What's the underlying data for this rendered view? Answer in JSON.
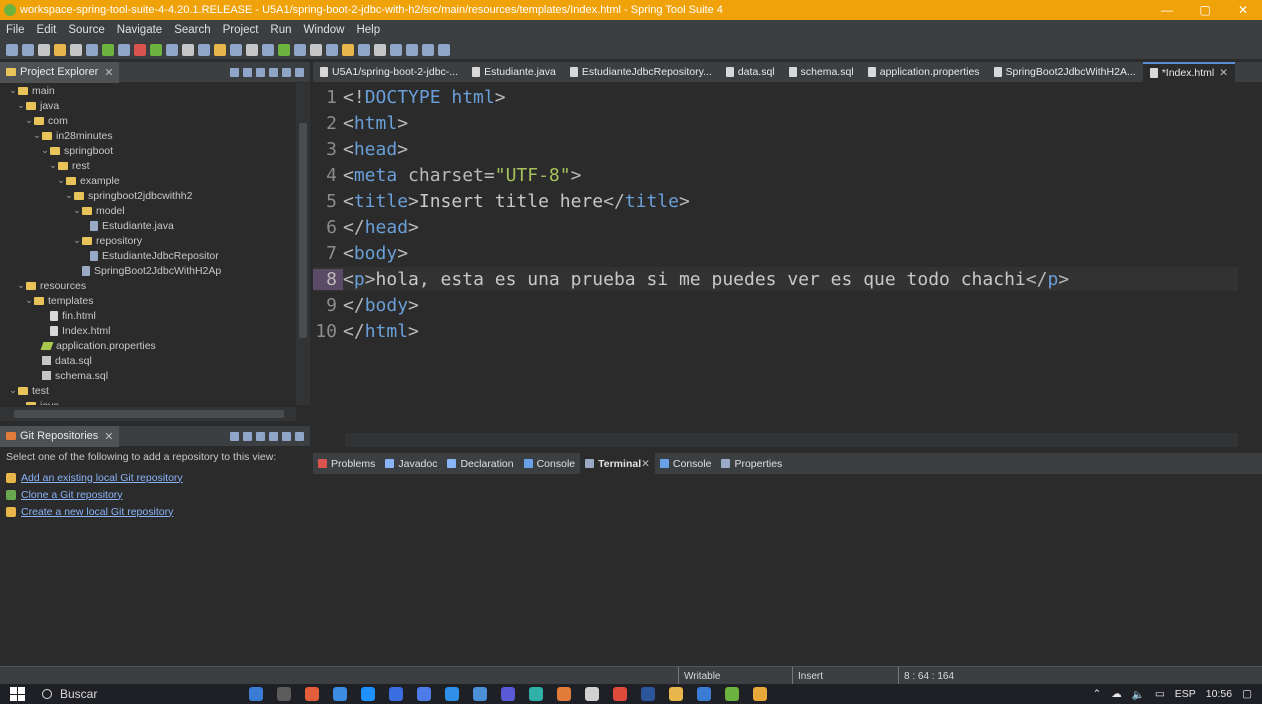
{
  "window": {
    "title": "workspace-spring-tool-suite-4-4.20.1.RELEASE - U5A1/spring-boot-2-jdbc-with-h2/src/main/resources/templates/Index.html - Spring Tool Suite 4",
    "minimize": "—",
    "maximize": "▢",
    "close": "✕"
  },
  "menu": [
    "File",
    "Edit",
    "Source",
    "Navigate",
    "Search",
    "Project",
    "Run",
    "Window",
    "Help"
  ],
  "explorer": {
    "tab_label": "Project Explorer",
    "tree": [
      {
        "indent": 1,
        "chev": "⌄",
        "type": "folder",
        "label": "main"
      },
      {
        "indent": 2,
        "chev": "⌄",
        "type": "folder",
        "label": "java"
      },
      {
        "indent": 3,
        "chev": "⌄",
        "type": "folder",
        "label": "com"
      },
      {
        "indent": 4,
        "chev": "⌄",
        "type": "folder",
        "label": "in28minutes"
      },
      {
        "indent": 5,
        "chev": "⌄",
        "type": "folder",
        "label": "springboot"
      },
      {
        "indent": 6,
        "chev": "⌄",
        "type": "folder",
        "label": "rest"
      },
      {
        "indent": 7,
        "chev": "⌄",
        "type": "folder",
        "label": "example"
      },
      {
        "indent": 8,
        "chev": "⌄",
        "type": "folder",
        "label": "springboot2jdbcwithh2"
      },
      {
        "indent": 9,
        "chev": "⌄",
        "type": "folder",
        "label": "model"
      },
      {
        "indent": 10,
        "chev": "",
        "type": "java",
        "label": "Estudiante.java"
      },
      {
        "indent": 9,
        "chev": "⌄",
        "type": "folder",
        "label": "repository"
      },
      {
        "indent": 10,
        "chev": "",
        "type": "java",
        "label": "EstudianteJdbcRepositor"
      },
      {
        "indent": 9,
        "chev": "",
        "type": "java",
        "label": "SpringBoot2JdbcWithH2Ap"
      },
      {
        "indent": 2,
        "chev": "⌄",
        "type": "folder",
        "label": "resources"
      },
      {
        "indent": 3,
        "chev": "⌄",
        "type": "folder",
        "label": "templates"
      },
      {
        "indent": 5,
        "chev": "",
        "type": "file",
        "label": "fin.html"
      },
      {
        "indent": 5,
        "chev": "",
        "type": "file",
        "label": "Index.html"
      },
      {
        "indent": 4,
        "chev": "",
        "type": "prop",
        "label": "application.properties"
      },
      {
        "indent": 4,
        "chev": "",
        "type": "sql",
        "label": "data.sql"
      },
      {
        "indent": 4,
        "chev": "",
        "type": "sql",
        "label": "schema.sql"
      },
      {
        "indent": 1,
        "chev": "⌄",
        "type": "folder",
        "label": "test"
      },
      {
        "indent": 2,
        "chev": "⌄",
        "type": "folder",
        "label": "java"
      }
    ]
  },
  "git": {
    "tab_label": "Git Repositories",
    "hint": "Select one of the following to add a repository to this view:",
    "links": [
      {
        "label": "Add an existing local Git repository",
        "color": "#e8b64a"
      },
      {
        "label": "Clone a Git repository",
        "color": "#6aa84f"
      },
      {
        "label": "Create a new local Git repository",
        "color": "#e8b64a"
      }
    ]
  },
  "editor_tabs": [
    {
      "label": "U5A1/spring-boot-2-jdbc-...",
      "active": false
    },
    {
      "label": "Estudiante.java",
      "active": false
    },
    {
      "label": "EstudianteJdbcRepository...",
      "active": false
    },
    {
      "label": "data.sql",
      "active": false
    },
    {
      "label": "schema.sql",
      "active": false
    },
    {
      "label": "application.properties",
      "active": false
    },
    {
      "label": "SpringBoot2JdbcWithH2A...",
      "active": false
    },
    {
      "label": "*Index.html",
      "active": true
    }
  ],
  "code": {
    "current_line": 8,
    "lines": [
      {
        "n": "1",
        "parts": [
          [
            "punct",
            "<!"
          ],
          [
            "tagc",
            "DOCTYPE html"
          ],
          [
            "punct",
            ">"
          ]
        ]
      },
      {
        "n": "2",
        "parts": [
          [
            "punct",
            "<"
          ],
          [
            "tagc",
            "html"
          ],
          [
            "punct",
            ">"
          ]
        ]
      },
      {
        "n": "3",
        "parts": [
          [
            "punct",
            "<"
          ],
          [
            "tagc",
            "head"
          ],
          [
            "punct",
            ">"
          ]
        ]
      },
      {
        "n": "4",
        "parts": [
          [
            "punct",
            "<"
          ],
          [
            "tagc",
            "meta "
          ],
          [
            "attr",
            "charset"
          ],
          [
            "punct",
            "="
          ],
          [
            "attrval",
            "\"UTF-8\""
          ],
          [
            "punct",
            ">"
          ]
        ]
      },
      {
        "n": "5",
        "parts": [
          [
            "punct",
            "<"
          ],
          [
            "tagc",
            "title"
          ],
          [
            "punct",
            ">"
          ],
          [
            "txt",
            "Insert title here"
          ],
          [
            "punct",
            "</"
          ],
          [
            "tagc",
            "title"
          ],
          [
            "punct",
            ">"
          ]
        ]
      },
      {
        "n": "6",
        "parts": [
          [
            "punct",
            "</"
          ],
          [
            "tagc",
            "head"
          ],
          [
            "punct",
            ">"
          ]
        ]
      },
      {
        "n": "7",
        "parts": [
          [
            "punct",
            "<"
          ],
          [
            "tagc",
            "body"
          ],
          [
            "punct",
            ">"
          ]
        ]
      },
      {
        "n": "8",
        "parts": [
          [
            "punct",
            "<"
          ],
          [
            "tagc",
            "p"
          ],
          [
            "punct",
            ">"
          ],
          [
            "txt",
            "hola, esta es una prueba si me puedes ver es que todo chachi"
          ],
          [
            "punct",
            "</"
          ],
          [
            "tagc",
            "p"
          ],
          [
            "punct",
            ">"
          ]
        ]
      },
      {
        "n": "9",
        "parts": [
          [
            "punct",
            "</"
          ],
          [
            "tagc",
            "body"
          ],
          [
            "punct",
            ">"
          ]
        ]
      },
      {
        "n": "10",
        "parts": [
          [
            "punct",
            "</"
          ],
          [
            "tagc",
            "html"
          ],
          [
            "punct",
            ">"
          ]
        ]
      }
    ]
  },
  "console_tabs": [
    {
      "label": "Problems",
      "color": "#d9534f",
      "active": false
    },
    {
      "label": "Javadoc",
      "color": "#8ab4f8",
      "active": false
    },
    {
      "label": "Declaration",
      "color": "#8ab4f8",
      "active": false
    },
    {
      "label": "Console",
      "color": "#6aa0e8",
      "active": false
    },
    {
      "label": "Terminal",
      "color": "#9aa9c6",
      "active": true
    },
    {
      "label": "Console",
      "color": "#6aa0e8",
      "active": false
    },
    {
      "label": "Properties",
      "color": "#9aa9c6",
      "active": false
    }
  ],
  "status": {
    "writable": "Writable",
    "insert": "Insert",
    "position": "8 : 64 : 164"
  },
  "taskbar": {
    "search": "Buscar",
    "lang": "ESP",
    "time": "10:56"
  }
}
